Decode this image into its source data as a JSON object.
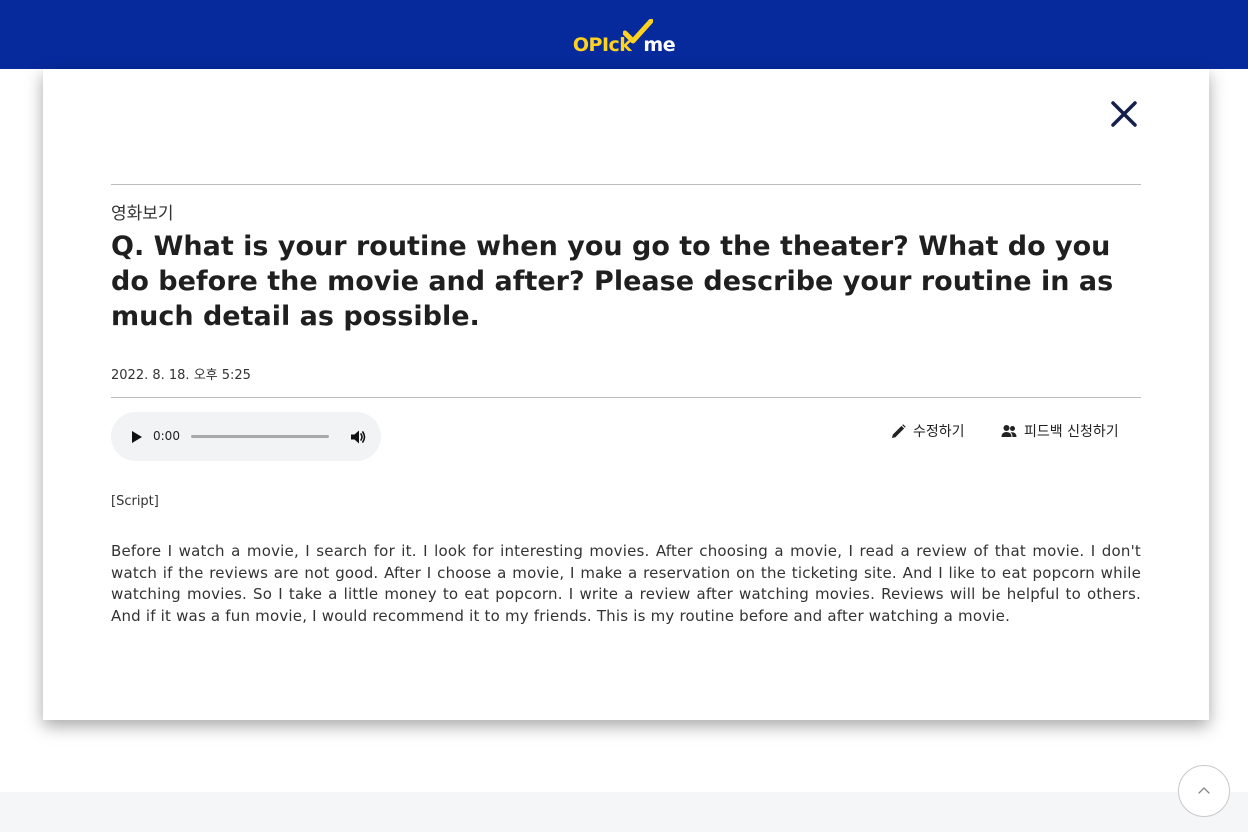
{
  "header": {
    "logo_opick": "OPIck",
    "logo_me": "me"
  },
  "card": {
    "category": "영화보기",
    "question": "Q. What is your routine when you go to the theater? What do you do before the movie and after? Please describe your routine in as much detail as possible.",
    "datetime": "2022. 8. 18. 오후 5:25",
    "audio": {
      "time": "0:00",
      "progress": 0
    },
    "actions": {
      "edit_label": "수정하기",
      "feedback_label": "피드백 신청하기"
    },
    "script_label": "[Script]",
    "script_body": "Before I watch a movie, I search for it. I look for interesting movies. After choosing a movie, I read a review of that movie. I don't watch if the reviews are not good. After I choose a movie, I make a reservation on the ticketing site. And I like to eat popcorn while watching movies. So I take a little money to eat popcorn. I write a review after watching movies. Reviews will be helpful to others. And if it was a fun movie, I would recommend it to my friends. This is my routine before and after watching a movie."
  },
  "colors": {
    "header_bg": "#062a9c",
    "logo_yellow": "#ffd21f",
    "close_icon": "#14204a"
  },
  "icons": {
    "close": "close-icon",
    "play": "play-icon",
    "volume": "volume-icon",
    "edit": "pencil-icon",
    "feedback": "users-icon",
    "scroll_top": "chevron-up-icon"
  }
}
